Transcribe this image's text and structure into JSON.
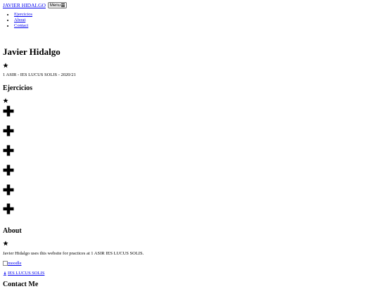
{
  "header": {
    "brand": "JAVIER HIDALGO",
    "menu_label": "Menu"
  },
  "nav": {
    "items": [
      "Ejercicios",
      "About",
      "Contact"
    ]
  },
  "hero": {
    "title": "Javier Hidalgo",
    "subtitle": "1 ASIR - IES LUCUS SOLIS - 2020/21"
  },
  "ejercicios": {
    "title": "Ejercicios",
    "item_count_icons": [
      "plus-icon",
      "plus-icon",
      "plus-icon",
      "plus-icon",
      "plus-icon",
      "plus-icon"
    ]
  },
  "about": {
    "title": "About",
    "text": "Javier Hidalgo uses this website for practices at 1 ASIR IES LUCUS SOLIS.",
    "image_alt": "moodle",
    "link_label": "IES LUCUS SOLIS"
  },
  "contact": {
    "title": "Contact Me"
  },
  "colors": {
    "link": "#0000ee",
    "text": "#000000"
  }
}
